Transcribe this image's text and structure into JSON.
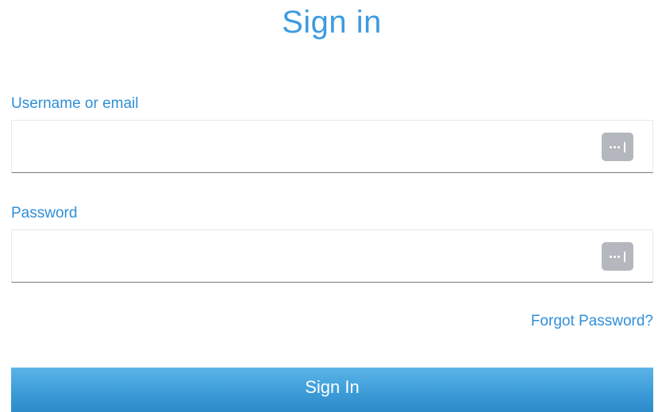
{
  "title": "Sign in",
  "username": {
    "label": "Username or email",
    "value": "",
    "icon": "password-manager-icon"
  },
  "password": {
    "label": "Password",
    "value": "",
    "icon": "password-manager-icon"
  },
  "forgot_password": "Forgot Password?",
  "submit_label": "Sign In",
  "colors": {
    "accent": "#2e8fd8",
    "title": "#3d9be0",
    "button_top": "#5cb4e8",
    "button_bottom": "#2e8bc9",
    "icon_bg": "#b5b7be"
  }
}
